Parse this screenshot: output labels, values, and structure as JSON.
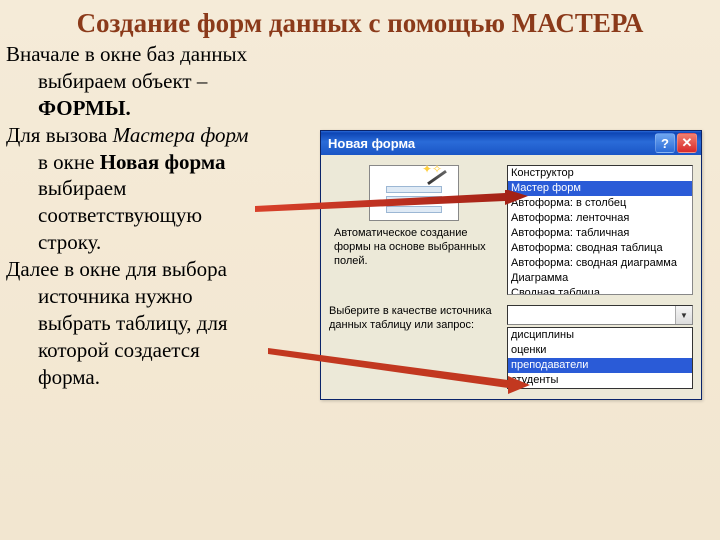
{
  "title": "Создание форм данных с помощью МАСТЕРА",
  "body": {
    "p1a": "Вначале в окне баз данных",
    "p1b": "выбираем объект –",
    "p1c": "ФОРМЫ.",
    "p2a": "Для вызова ",
    "p2b": "Мастера форм",
    "p2c": "в окне ",
    "p2d": "Новая форма",
    "p2e": "выбираем",
    "p2f": "соответствующую",
    "p2g": "строку.",
    "p3a": "Далее в окне для выбора",
    "p3b": "источника нужно",
    "p3c": "выбрать таблицу, для",
    "p3d": "которой создается",
    "p3e": "форма."
  },
  "dialog": {
    "title": "Новая форма",
    "help": "?",
    "close": "✕",
    "preview_caption": "Автоматическое создание формы на основе выбранных полей.",
    "options": [
      "Конструктор",
      "Мастер форм",
      "Автоформа: в столбец",
      "Автоформа: ленточная",
      "Автоформа: табличная",
      "Автоформа:  сводная таблица",
      "Автоформа:  сводная диаграмма",
      "Диаграмма",
      "Сводная таблица"
    ],
    "selected_option_index": 1,
    "source_label": "Выберите в качестве источника данных таблицу или запрос:",
    "source_value": "",
    "dropdown_items": [
      "дисциплины",
      "оценки",
      "преподаватели",
      "студенты"
    ],
    "selected_dropdown_index": 2
  },
  "colors": {
    "title": "#8b3a1a",
    "selection": "#2a5bd7",
    "xp_blue": "#2a6bd8"
  }
}
